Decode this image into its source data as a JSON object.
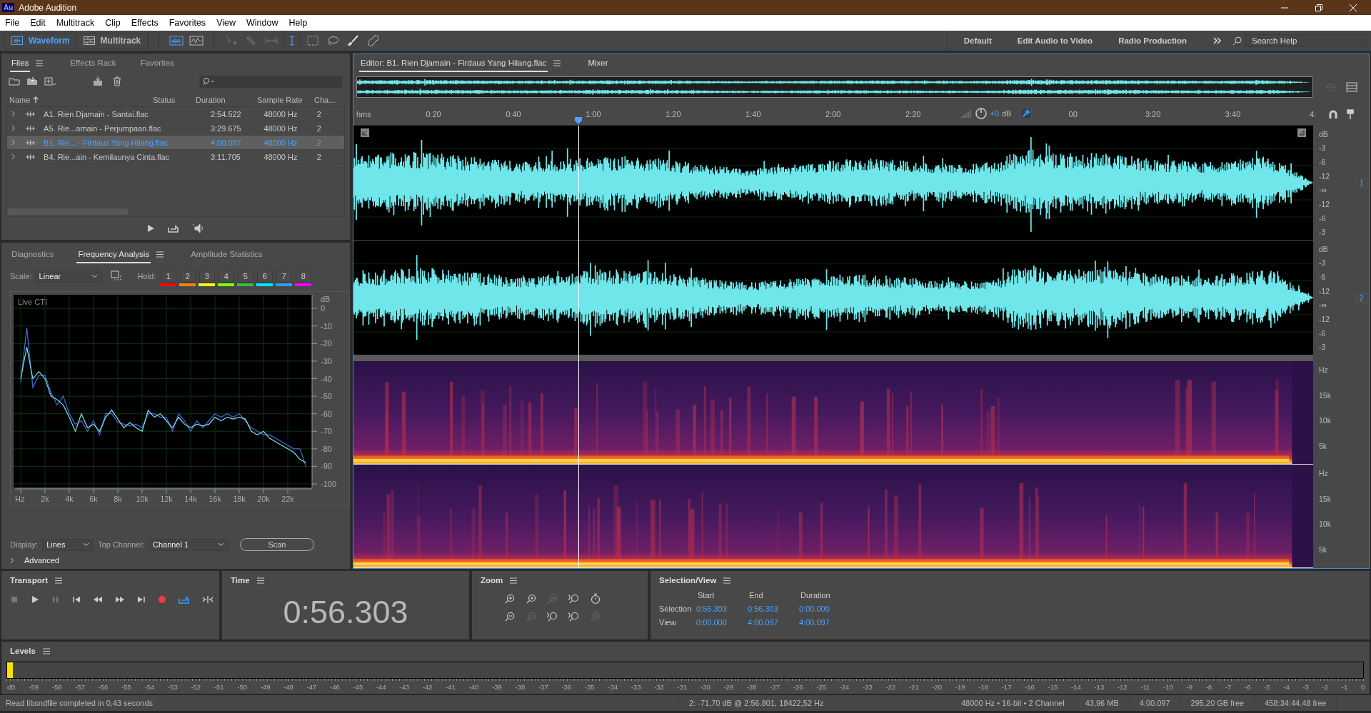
{
  "window": {
    "badge": "Au",
    "title": "Adobe Audition"
  },
  "menu": [
    "File",
    "Edit",
    "Multitrack",
    "Clip",
    "Effects",
    "Favorites",
    "View",
    "Window",
    "Help"
  ],
  "toolbar": {
    "modes": [
      {
        "label": "Waveform",
        "selected": true
      },
      {
        "label": "Multitrack",
        "selected": false
      }
    ],
    "workspaces": [
      "Default",
      "Edit Audio to Video",
      "Radio Production"
    ],
    "search": {
      "placeholder": "Search Help"
    }
  },
  "files": {
    "tabs": [
      {
        "label": "Files",
        "selected": true
      },
      {
        "label": "Effects Rack",
        "selected": false
      },
      {
        "label": "Favorites",
        "selected": false
      }
    ],
    "columns": [
      "Name",
      "Status",
      "Duration",
      "Sample Rate",
      "Cha..."
    ],
    "rows": [
      {
        "name": "A1. Rien Djamain - Santai.flac",
        "duration": "2:54.522",
        "sample_rate": "48000 Hz",
        "channels": "2",
        "selected": false
      },
      {
        "name": "A5. Rie...amain - Perjumpaan.flac",
        "duration": "3:29.675",
        "sample_rate": "48000 Hz",
        "channels": "2",
        "selected": false
      },
      {
        "name": "B1. Rie... - Firdaus Yang Hilang.flac",
        "duration": "4:00.097",
        "sample_rate": "48000 Hz",
        "channels": "2",
        "selected": true
      },
      {
        "name": "B4. Rie...ain - Kemilaunya Cinta.flac",
        "duration": "3:11.705",
        "sample_rate": "48000 Hz",
        "channels": "2",
        "selected": false
      }
    ]
  },
  "analysis": {
    "tabs": [
      {
        "label": "Diagnostics",
        "selected": false
      },
      {
        "label": "Frequency Analysis",
        "selected": true
      },
      {
        "label": "Amplitude Statistics",
        "selected": false
      }
    ],
    "scale_label": "Scale:",
    "scale_value": "Linear",
    "hold_label": "Hold:",
    "hold": [
      {
        "label": "1",
        "color": "#ff0000"
      },
      {
        "label": "2",
        "color": "#ff8000"
      },
      {
        "label": "3",
        "color": "#ffff00"
      },
      {
        "label": "4",
        "color": "#80ff00"
      },
      {
        "label": "5",
        "color": "#33c033"
      },
      {
        "label": "6",
        "color": "#00e5ff"
      },
      {
        "label": "7",
        "color": "#3399ff"
      },
      {
        "label": "8",
        "color": "#ff00ff"
      }
    ],
    "chart_label": "Live CTI",
    "chart_data": {
      "type": "line",
      "ylabel": "dB",
      "grid": true,
      "xlim": [
        0,
        24
      ],
      "ylim": [
        -100,
        7
      ],
      "xticks": [
        {
          "value": 0,
          "label": "Hz"
        },
        {
          "value": 2,
          "label": "2k"
        },
        {
          "value": 4,
          "label": "4k"
        },
        {
          "value": 6,
          "label": "6k"
        },
        {
          "value": 8,
          "label": "8k"
        },
        {
          "value": 10,
          "label": "10k"
        },
        {
          "value": 12,
          "label": "12k"
        },
        {
          "value": 14,
          "label": "14k"
        },
        {
          "value": 16,
          "label": "16k"
        },
        {
          "value": 18,
          "label": "18k"
        },
        {
          "value": 20,
          "label": "20k"
        },
        {
          "value": 22,
          "label": "22k"
        }
      ],
      "yticks": [
        0,
        -10,
        -20,
        -30,
        -40,
        -50,
        -60,
        -70,
        -80,
        -90,
        -100
      ],
      "x": [
        0,
        0.5,
        1,
        1.5,
        2,
        2.5,
        3,
        3.5,
        4,
        4.5,
        5,
        5.5,
        6,
        6.5,
        7,
        7.5,
        8,
        8.5,
        9,
        9.5,
        10,
        10.5,
        11,
        11.5,
        12,
        12.5,
        13,
        13.5,
        14,
        14.5,
        15,
        15.5,
        16,
        16.5,
        17,
        17.5,
        18,
        18.5,
        19,
        19.5,
        20,
        20.5,
        21,
        21.5,
        22,
        22.5,
        23,
        23.5
      ],
      "series": [
        {
          "color": "#3f6fd8",
          "values": [
            -42,
            -11,
            -45,
            -38,
            -38,
            -48,
            -55,
            -50,
            -60,
            -66,
            -64,
            -70,
            -64,
            -72,
            -60,
            -60,
            -65,
            -66,
            -67,
            -66,
            -68,
            -60,
            -60,
            -62,
            -62,
            -70,
            -60,
            -64,
            -70,
            -64,
            -68,
            -64,
            -60,
            -62,
            -60,
            -62,
            -60,
            -64,
            -68,
            -70,
            -72,
            -72,
            -74,
            -76,
            -78,
            -80,
            -80,
            -90
          ]
        },
        {
          "color": "#7fe0e8",
          "values": [
            -40,
            -22,
            -40,
            -36,
            -40,
            -50,
            -52,
            -55,
            -62,
            -70,
            -60,
            -68,
            -66,
            -70,
            -62,
            -58,
            -63,
            -68,
            -65,
            -68,
            -70,
            -58,
            -62,
            -60,
            -64,
            -68,
            -62,
            -66,
            -68,
            -66,
            -67,
            -66,
            -62,
            -64,
            -62,
            -63,
            -62,
            -63,
            -70,
            -72,
            -70,
            -74,
            -76,
            -78,
            -80,
            -82,
            -86,
            -88
          ]
        }
      ]
    },
    "display_label": "Display:",
    "display_value": "Lines",
    "top_channel_label": "Top Channel:",
    "top_channel_value": "Channel 1",
    "scan": "Scan",
    "advanced": "Advanced"
  },
  "editor": {
    "tabs": [
      {
        "label": "Editor: B1. Rien Djamain - Firdaus Yang Hilang.flac",
        "selected": true
      },
      {
        "label": "Mixer",
        "selected": false
      }
    ],
    "ruler_unit": "hms",
    "ruler": [
      "0:20",
      "0:40",
      "1:00",
      "1:20",
      "1:40",
      "2:00",
      "2:20",
      "00",
      "3:20",
      "3:40",
      "4:"
    ],
    "gain": "+0",
    "gain_unit": "dB",
    "channels": [
      {
        "badge": "1",
        "scale": [
          "dB",
          "-3",
          "-6",
          "-12",
          "-∞",
          "-12",
          "-6",
          "-3"
        ],
        "spectrum_scale": [
          "Hz",
          "15k",
          "10k",
          "5k"
        ]
      },
      {
        "badge": "2",
        "scale": [
          "dB",
          "-3",
          "-6",
          "-12",
          "-∞",
          "-12",
          "-6",
          "-3"
        ],
        "spectrum_scale": [
          "Hz",
          "15k",
          "10k",
          "5k"
        ]
      }
    ]
  },
  "transport": {
    "title": "Transport",
    "loop": true
  },
  "time": {
    "title": "Time",
    "value": "0:56.303"
  },
  "zoom": {
    "title": "Zoom",
    "buttons": [
      {
        "kind": "in",
        "disabled": false
      },
      {
        "kind": "in",
        "disabled": false
      },
      {
        "kind": "in",
        "disabled": true
      },
      {
        "kind": "selection",
        "disabled": false
      },
      {
        "kind": "reset",
        "disabled": false
      },
      {
        "kind": "out",
        "disabled": false
      },
      {
        "kind": "out",
        "disabled": true
      },
      {
        "kind": "selection",
        "disabled": false
      },
      {
        "kind": "selection",
        "disabled": false
      },
      {
        "kind": "in",
        "disabled": true
      }
    ]
  },
  "selection_view": {
    "title": "Selection/View",
    "columns": [
      "Start",
      "End",
      "Duration"
    ],
    "rows": [
      {
        "label": "Selection",
        "start": "0:56.303",
        "end": "0:56.303",
        "duration": "0:00.000"
      },
      {
        "label": "View",
        "start": "0:00.000",
        "end": "4:00.097",
        "duration": "4:00.097"
      }
    ]
  },
  "levels": {
    "title": "Levels",
    "level": 0.004,
    "scale": [
      "dB",
      "-59",
      "-58",
      "-57",
      "-56",
      "-55",
      "-54",
      "-53",
      "-52",
      "-51",
      "-50",
      "-49",
      "-48",
      "-47",
      "-46",
      "-45",
      "-44",
      "-43",
      "-42",
      "-41",
      "-40",
      "-39",
      "-38",
      "-37",
      "-36",
      "-35",
      "-34",
      "-33",
      "-32",
      "-31",
      "-30",
      "-29",
      "-28",
      "-27",
      "-26",
      "-25",
      "-24",
      "-23",
      "-22",
      "-21",
      "-20",
      "-19",
      "-18",
      "-17",
      "-16",
      "-15",
      "-14",
      "-13",
      "-12",
      "-11",
      "-10",
      "-9",
      "-8",
      "-7",
      "-6",
      "-5",
      "-4",
      "-3",
      "-2",
      "-1",
      "0"
    ]
  },
  "status_bar": {
    "message": "Read libsndfile completed in 0,43 seconds",
    "cursor": "2: -71,70 dB @ 2:56.801, 18422,52 Hz",
    "format": "48000 Hz • 16-bit • 2 Channel",
    "size": "43,96 MB",
    "duration": "4:00.097",
    "disk_free": "295,20 GB free",
    "time_free": "458:34:44.48 free"
  }
}
